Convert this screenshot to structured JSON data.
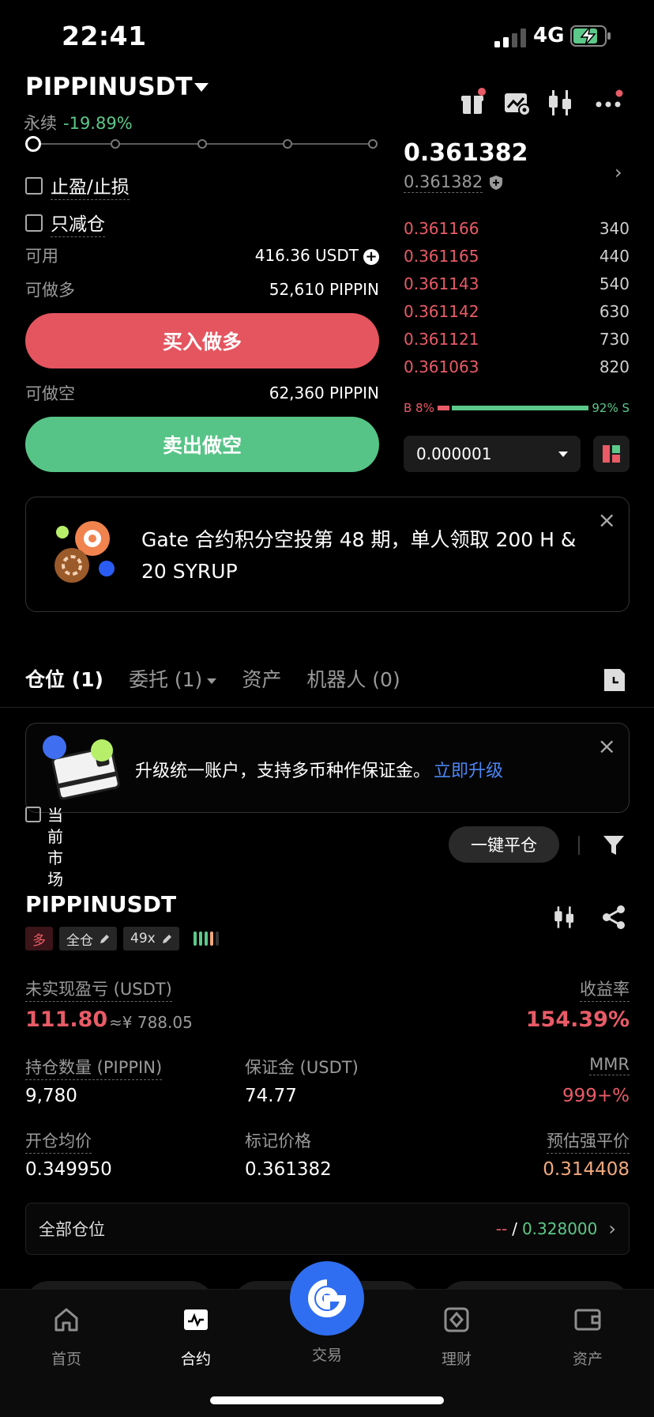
{
  "status_bar": {
    "time": "22:41",
    "network": "4G"
  },
  "header": {
    "pair": "PIPPINUSDT",
    "type_label": "永续",
    "change_pct": "-19.89%"
  },
  "order_form": {
    "tp_sl_label": "止盈/止损",
    "reduce_only_label": "只减仓",
    "available_label": "可用",
    "available_value": "416.36 USDT",
    "max_long_label": "可做多",
    "max_long_value": "52,610 PIPPIN",
    "buy_label": "买入做多",
    "max_short_label": "可做空",
    "max_short_value": "62,360 PIPPIN",
    "sell_label": "卖出做空",
    "leverage_slider_position": 0
  },
  "orderbook": {
    "last_price": "0.361382",
    "mark_price": "0.361382",
    "asks": [
      {
        "price": "0.361166",
        "qty": "340"
      },
      {
        "price": "0.361165",
        "qty": "440"
      },
      {
        "price": "0.361143",
        "qty": "540"
      },
      {
        "price": "0.361142",
        "qty": "630"
      },
      {
        "price": "0.361121",
        "qty": "730"
      },
      {
        "price": "0.361063",
        "qty": "820"
      }
    ],
    "buy_ratio_label": "B 8%",
    "sell_ratio_label": "92% S",
    "buy_ratio": 0.08,
    "precision": "0.000001"
  },
  "promo": {
    "text": "Gate 合约积分空投第 48 期，单人领取 200 H & 20 SYRUP",
    "close": "×"
  },
  "tabs": [
    {
      "label": "仓位 (1)"
    },
    {
      "label": "委托 (1)"
    },
    {
      "label": "资产"
    },
    {
      "label": "机器人 (0)"
    }
  ],
  "upgrade": {
    "text": "升级统一账户，支持多币种作保证金。",
    "link": "立即升级",
    "close": "×"
  },
  "filters": {
    "current_market_label": "当前市场",
    "close_all_label": "一键平仓"
  },
  "position": {
    "symbol": "PIPPINUSDT",
    "side_tag": "多",
    "margin_mode_tag": "全仓",
    "leverage_tag": "49x",
    "unrealized_pnl_label": "未实现盈亏 (USDT)",
    "unrealized_pnl_value": "111.80",
    "unrealized_pnl_cny": "≈¥ 788.05",
    "roe_label": "收益率",
    "roe_value": "154.39%",
    "qty_label": "持仓数量 (PIPPIN)",
    "qty_value": "9,780",
    "margin_label": "保证金 (USDT)",
    "margin_value": "74.77",
    "mmr_label": "MMR",
    "mmr_value": "999+%",
    "entry_label": "开仓均价",
    "entry_value": "0.349950",
    "markp_label": "标记价格",
    "markp_value": "0.361382",
    "liq_label": "预估强平价",
    "liq_value": "0.314408",
    "all_positions_label": "全部仓位",
    "tp_value": "--",
    "sl_sep": "/",
    "sl_value": "0.328000"
  },
  "bottom_nav": [
    {
      "label": "首页",
      "icon": "home-icon"
    },
    {
      "label": "合约",
      "icon": "futures-icon"
    },
    {
      "label": "交易",
      "icon": "gate-logo-icon"
    },
    {
      "label": "理财",
      "icon": "earn-icon"
    },
    {
      "label": "资产",
      "icon": "wallet-icon"
    }
  ],
  "colors": {
    "buy": "#e5555f",
    "sell": "#57c487",
    "accent": "#2f6ef0",
    "liquidation": "#f2a97e"
  }
}
